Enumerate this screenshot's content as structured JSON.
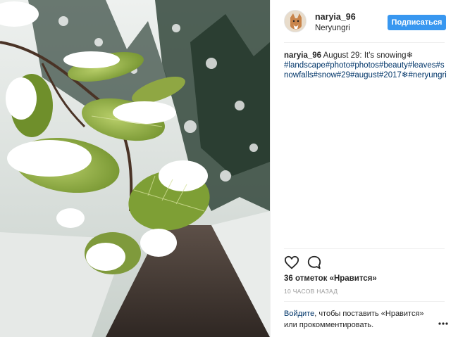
{
  "post": {
    "username": "naryia_96",
    "location": "Neryungri",
    "follow_label": "Подписаться",
    "caption": {
      "username": "naryia_96",
      "text": " August 29: It's snowing❄",
      "tags": "#landscape#photo#photos#beauty#leaves#snowfalls#snow#29#august#2017❄#neryungri"
    },
    "likes": "36 отметок «Нравится»",
    "time": "10 ЧАСОВ НАЗАД",
    "comment": {
      "login_link": "Войдите",
      "rest": ", чтобы поставить «Нравится» или прокомментировать."
    }
  },
  "icons": {
    "like": "heart-icon",
    "comment": "comment-icon",
    "more": "more-options-icon"
  },
  "colors": {
    "follow_button": "#3897f0",
    "link": "#003569",
    "muted": "#999999"
  }
}
